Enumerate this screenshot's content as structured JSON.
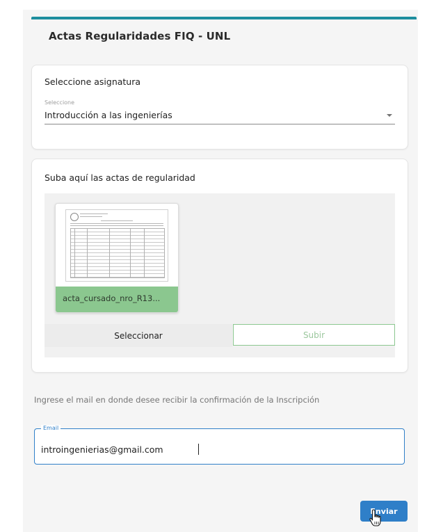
{
  "header": {
    "title": "Actas Regularidades FIQ - UNL"
  },
  "subject_card": {
    "title": "Seleccione asignatura",
    "select_label": "Seleccione",
    "selected_value": "Introducción a las ingenierías"
  },
  "upload_card": {
    "title": "Suba aquí las actas de regularidad",
    "file_name": "acta_cursado_nro_R13...",
    "select_button": "Seleccionar",
    "upload_button": "Subir"
  },
  "email_section": {
    "instruction": "Ingrese el mail en donde desee recibir la confirmación de la Inscripción",
    "label": "Email",
    "value": "introingenierias@gmail.com"
  },
  "actions": {
    "send_button": "Enviar"
  },
  "colors": {
    "accent": "#1e8e9e",
    "primary": "#2f7fc8",
    "success": "#8bc78f"
  }
}
